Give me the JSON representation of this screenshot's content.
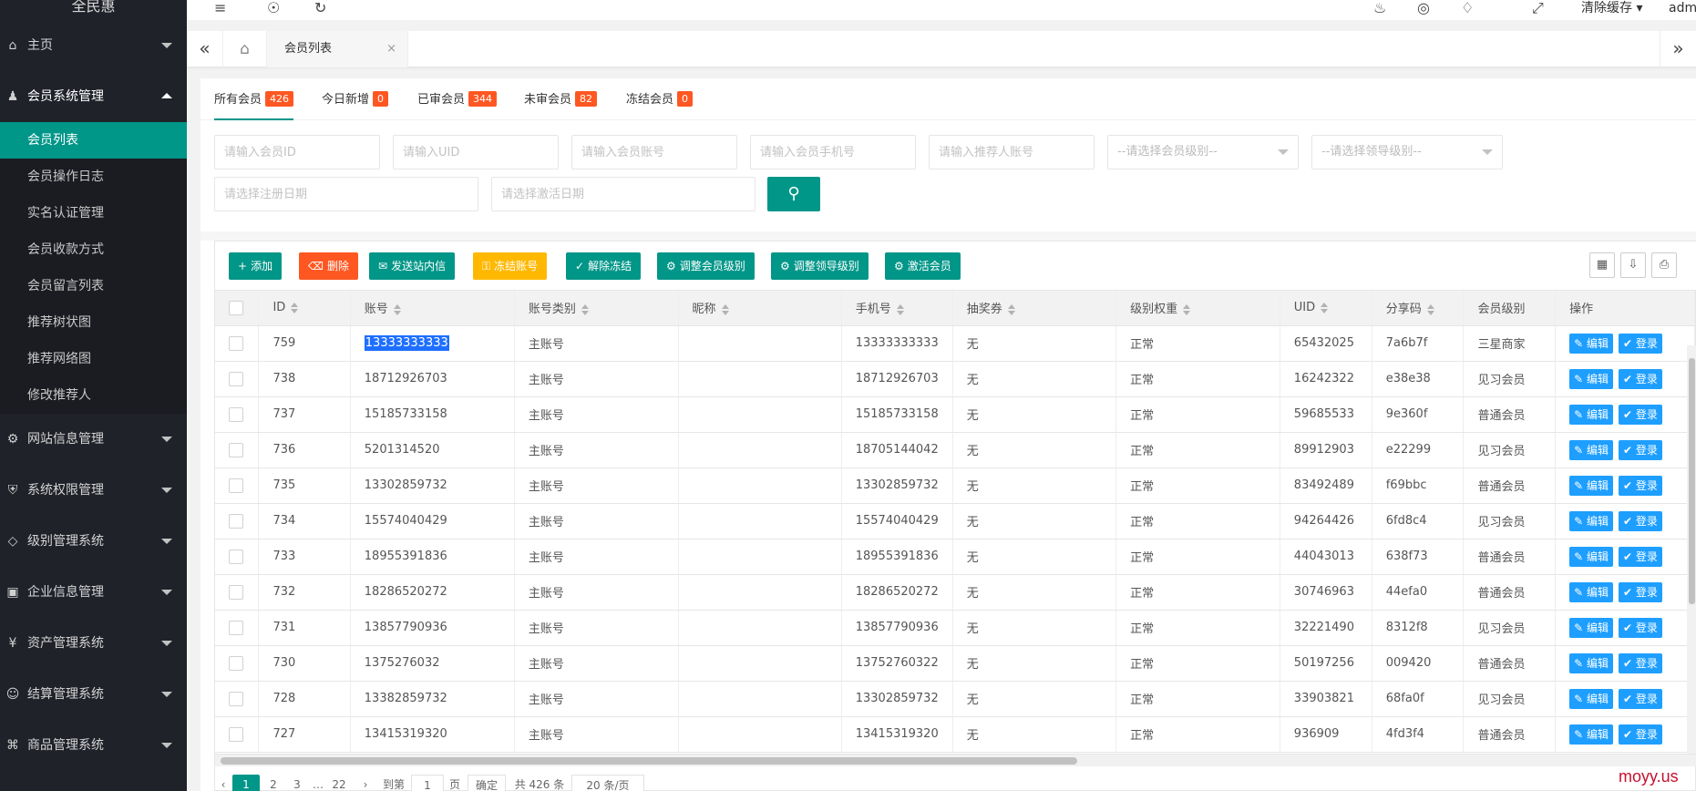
{
  "app": {
    "logo": "全民惠",
    "watermark": "moyy.us"
  },
  "sidebar": {
    "groups": [
      {
        "label": "主页",
        "icon": "home-icon",
        "open": false
      },
      {
        "label": "会员系统管理",
        "icon": "users-icon",
        "open": true,
        "items": [
          {
            "label": "会员列表",
            "active": true
          },
          {
            "label": "会员操作日志"
          },
          {
            "label": "实名认证管理"
          },
          {
            "label": "会员收款方式"
          },
          {
            "label": "会员留言列表"
          },
          {
            "label": "推荐树状图"
          },
          {
            "label": "推荐网络图"
          },
          {
            "label": "修改推荐人"
          }
        ]
      },
      {
        "label": "网站信息管理",
        "icon": "gear-icon",
        "open": false
      },
      {
        "label": "系统权限管理",
        "icon": "shield-icon",
        "open": false
      },
      {
        "label": "级别管理系统",
        "icon": "diamond-icon",
        "open": false
      },
      {
        "label": "企业信息管理",
        "icon": "building-icon",
        "open": false
      },
      {
        "label": "资产管理系统",
        "icon": "yen-icon",
        "open": false
      },
      {
        "label": "结算管理系统",
        "icon": "smile-icon",
        "open": false
      },
      {
        "label": "商品管理系统",
        "icon": "cart-icon",
        "open": false
      }
    ]
  },
  "topbar": {
    "icons": [
      "menu-fold-icon",
      "globe-icon",
      "refresh-icon",
      "bell-icon",
      "palette-icon",
      "tag-icon",
      "fullscreen-icon"
    ],
    "clear_cache": "清除缓存",
    "user": "admi"
  },
  "tabbar": {
    "tab_label": "会员列表",
    "close": "×"
  },
  "status_tabs": [
    {
      "label": "所有会员",
      "count": "426"
    },
    {
      "label": "今日新增",
      "count": "0"
    },
    {
      "label": "已审会员",
      "count": "344"
    },
    {
      "label": "未审会员",
      "count": "82"
    },
    {
      "label": "冻结会员",
      "count": "0"
    }
  ],
  "filters": {
    "member_id": "请输入会员ID",
    "uid": "请输入UID",
    "account": "请输入会员账号",
    "phone": "请输入会员手机号",
    "referrer": "请输入推荐人账号",
    "member_level": "--请选择会员级别--",
    "leader_level": "--请选择领导级别--",
    "reg_date": "请选择注册日期",
    "act_date": "请选择激活日期"
  },
  "toolbar": {
    "add": "添加",
    "delete": "删除",
    "send_msg": "发送站内信",
    "freeze": "冻结账号",
    "unfreeze": "解除冻结",
    "adjust_member": "调整会员级别",
    "adjust_leader": "调整领导级别",
    "activate": "激活会员"
  },
  "table": {
    "headers": [
      "ID",
      "账号",
      "账号类别",
      "昵称",
      "手机号",
      "抽奖券",
      "级别权重",
      "UID",
      "分享码",
      "会员级别",
      "操作"
    ],
    "edit_label": "编辑",
    "login_label": "登录",
    "rows": [
      {
        "id": "759",
        "account": "13333333333",
        "type": "主账号",
        "nick": "",
        "phone": "13333333333",
        "coupon": "无",
        "weight": "正常",
        "uid": "65432025",
        "code": "7a6b7f",
        "level": "三星商家"
      },
      {
        "id": "738",
        "account": "18712926703",
        "type": "主账号",
        "nick": "",
        "phone": "18712926703",
        "coupon": "无",
        "weight": "正常",
        "uid": "16242322",
        "code": "e38e38",
        "level": "见习会员"
      },
      {
        "id": "737",
        "account": "15185733158",
        "type": "主账号",
        "nick": "",
        "phone": "15185733158",
        "coupon": "无",
        "weight": "正常",
        "uid": "59685533",
        "code": "9e360f",
        "level": "普通会员"
      },
      {
        "id": "736",
        "account": "5201314520",
        "type": "主账号",
        "nick": "",
        "phone": "18705144042",
        "coupon": "无",
        "weight": "正常",
        "uid": "89912903",
        "code": "e22299",
        "level": "见习会员"
      },
      {
        "id": "735",
        "account": "13302859732",
        "type": "主账号",
        "nick": "",
        "phone": "13302859732",
        "coupon": "无",
        "weight": "正常",
        "uid": "83492489",
        "code": "f69bbc",
        "level": "普通会员"
      },
      {
        "id": "734",
        "account": "15574040429",
        "type": "主账号",
        "nick": "",
        "phone": "15574040429",
        "coupon": "无",
        "weight": "正常",
        "uid": "94264426",
        "code": "6fd8c4",
        "level": "见习会员"
      },
      {
        "id": "733",
        "account": "18955391836",
        "type": "主账号",
        "nick": "",
        "phone": "18955391836",
        "coupon": "无",
        "weight": "正常",
        "uid": "44043013",
        "code": "638f73",
        "level": "普通会员"
      },
      {
        "id": "732",
        "account": "18286520272",
        "type": "主账号",
        "nick": "",
        "phone": "18286520272",
        "coupon": "无",
        "weight": "正常",
        "uid": "30746963",
        "code": "44efa0",
        "level": "普通会员"
      },
      {
        "id": "731",
        "account": "13857790936",
        "type": "主账号",
        "nick": "",
        "phone": "13857790936",
        "coupon": "无",
        "weight": "正常",
        "uid": "32221490",
        "code": "8312f8",
        "level": "见习会员"
      },
      {
        "id": "730",
        "account": "1375276032",
        "type": "主账号",
        "nick": "",
        "phone": "13752760322",
        "coupon": "无",
        "weight": "正常",
        "uid": "50197256",
        "code": "009420",
        "level": "普通会员"
      },
      {
        "id": "728",
        "account": "13382859732",
        "type": "主账号",
        "nick": "",
        "phone": "13302859732",
        "coupon": "无",
        "weight": "正常",
        "uid": "33903821",
        "code": "68fa0f",
        "level": "见习会员"
      },
      {
        "id": "727",
        "account": "13415319320",
        "type": "主账号",
        "nick": "",
        "phone": "13415319320",
        "coupon": "无",
        "weight": "正常",
        "uid": "936909",
        "code": "4fd3f4",
        "level": "普通会员"
      }
    ]
  },
  "pager": {
    "pages": [
      "1",
      "2",
      "3",
      "22"
    ],
    "goto_label": "到第",
    "page_unit": "页",
    "confirm": "确定",
    "total": "共 426 条",
    "per_page": "20 条/页"
  },
  "colors": {
    "primary": "#009688",
    "danger": "#ff5722",
    "warning": "#ffb800",
    "info": "#1e9fff",
    "sidebar": "#20222a"
  }
}
